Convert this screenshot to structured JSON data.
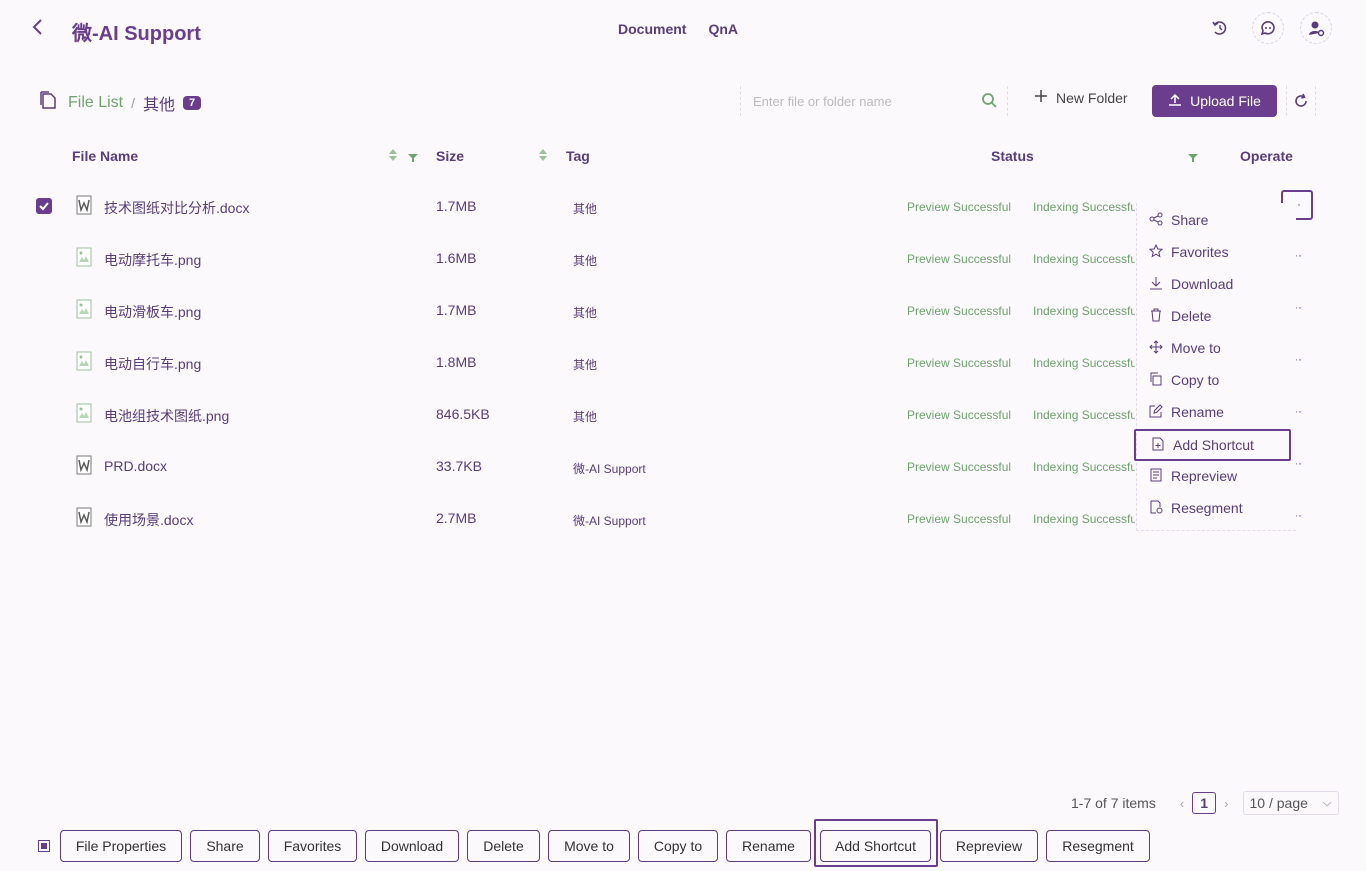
{
  "header": {
    "app_title": "微-AI Support",
    "nav": [
      "Document",
      "QnA"
    ]
  },
  "breadcrumb": {
    "root": "File List",
    "separator": "/",
    "current": "其他",
    "count": "7"
  },
  "toolbar": {
    "search_placeholder": "Enter file or folder name",
    "new_folder": "New Folder",
    "upload": "Upload File"
  },
  "columns": {
    "name": "File Name",
    "size": "Size",
    "tag": "Tag",
    "status": "Status",
    "operate": "Operate"
  },
  "files": [
    {
      "name": "技术图纸对比分析.docx",
      "size": "1.7MB",
      "tag": "其他",
      "preview": "Preview Successful",
      "index": "Indexing Successful",
      "type": "docx",
      "checked": true
    },
    {
      "name": "电动摩托车.png",
      "size": "1.6MB",
      "tag": "其他",
      "preview": "Preview Successful",
      "index": "Indexing Successful",
      "type": "png",
      "checked": false
    },
    {
      "name": "电动滑板车.png",
      "size": "1.7MB",
      "tag": "其他",
      "preview": "Preview Successful",
      "index": "Indexing Successful",
      "type": "png",
      "checked": false
    },
    {
      "name": "电动自行车.png",
      "size": "1.8MB",
      "tag": "其他",
      "preview": "Preview Successful",
      "index": "Indexing Successful",
      "type": "png",
      "checked": false
    },
    {
      "name": "电池组技术图纸.png",
      "size": "846.5KB",
      "tag": "其他",
      "preview": "Preview Successful",
      "index": "Indexing Successful",
      "type": "png",
      "checked": false
    },
    {
      "name": "PRD.docx",
      "size": "33.7KB",
      "tag": "微-AI Support",
      "preview": "Preview Successful",
      "index": "Indexing Successful",
      "type": "docx",
      "checked": false
    },
    {
      "name": "使用场景.docx",
      "size": "2.7MB",
      "tag": "微-AI Support",
      "preview": "Preview Successful",
      "index": "Indexing Successful",
      "type": "docx",
      "checked": false
    }
  ],
  "menu": [
    {
      "label": "Share",
      "icon": "share-icon"
    },
    {
      "label": "Favorites",
      "icon": "star-icon"
    },
    {
      "label": "Download",
      "icon": "download-icon"
    },
    {
      "label": "Delete",
      "icon": "trash-icon"
    },
    {
      "label": "Move to",
      "icon": "move-icon"
    },
    {
      "label": "Copy to",
      "icon": "copy-icon"
    },
    {
      "label": "Rename",
      "icon": "edit-icon"
    },
    {
      "label": "Add Shortcut",
      "icon": "shortcut-file-icon"
    },
    {
      "label": "Repreview",
      "icon": "repreview-icon"
    },
    {
      "label": "Resegment",
      "icon": "resegment-icon"
    }
  ],
  "pagination": {
    "total": "1-7 of 7 items",
    "page": "1",
    "page_size": "10 / page"
  },
  "bulk_actions": [
    "File Properties",
    "Share",
    "Favorites",
    "Download",
    "Delete",
    "Move to",
    "Copy to",
    "Rename",
    "Add Shortcut",
    "Repreview",
    "Resegment"
  ],
  "colors": {
    "accent": "#6a3d8f",
    "success": "#6da36d",
    "background": "#fbf9fc"
  }
}
